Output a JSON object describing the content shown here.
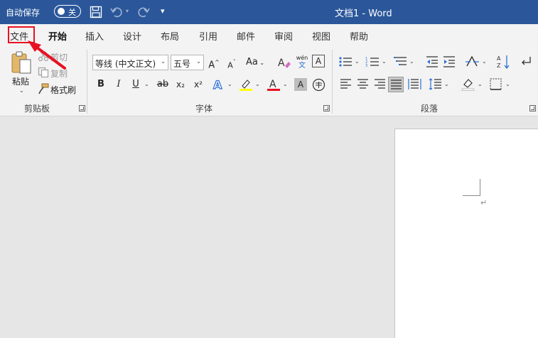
{
  "titlebar": {
    "autosave_label": "自动保存",
    "autosave_state": "关",
    "title": "文档1  -  Word",
    "brand_color": "#2b579a"
  },
  "tabs": [
    {
      "label": "文件"
    },
    {
      "label": "开始"
    },
    {
      "label": "插入"
    },
    {
      "label": "设计"
    },
    {
      "label": "布局"
    },
    {
      "label": "引用"
    },
    {
      "label": "邮件"
    },
    {
      "label": "审阅"
    },
    {
      "label": "视图"
    },
    {
      "label": "帮助"
    }
  ],
  "active_tab": "开始",
  "clipboard": {
    "paste_label": "粘贴",
    "cut_label": "剪切",
    "copy_label": "复制",
    "format_painter_label": "格式刷",
    "group_label": "剪贴板"
  },
  "font": {
    "font_name": "等线 (中文正文)",
    "font_size": "五号",
    "group_label": "字体",
    "bold": "B",
    "italic": "I",
    "underline": "U",
    "strikethrough": "ab",
    "subscript": "x₂",
    "superscript": "x²",
    "grow": "A",
    "shrink": "A",
    "change_case": "Aa",
    "phonetic_top": "wén",
    "phonetic_bottom": "文",
    "char_border": "A",
    "font_color_letter": "A",
    "highlight_color": "#ffff00",
    "font_color": "#e81123",
    "text_effect_color": "#2f6fd6"
  },
  "paragraph": {
    "group_label": "段落"
  },
  "annotation": {
    "highlight_color": "#e81123"
  }
}
